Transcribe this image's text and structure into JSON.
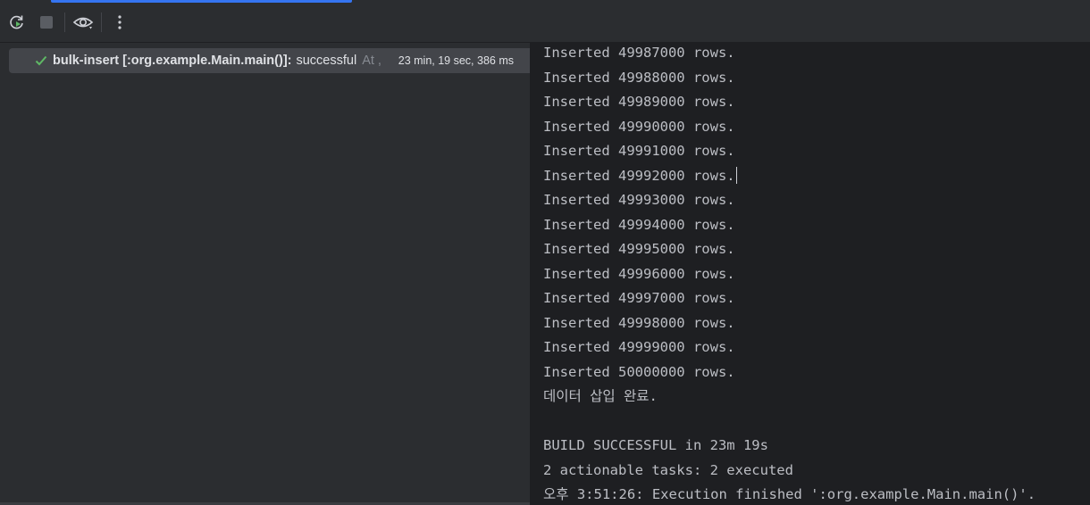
{
  "toolbar": {
    "rerun_icon": "rerun-icon",
    "stop_icon": "stop-icon",
    "view_icon": "eye-icon",
    "more_icon": "more-vertical-icon"
  },
  "tree": {
    "name": "bulk-insert [:org.example.Main.main()]:",
    "status": "successful",
    "at": "At ,",
    "duration": "23 min, 19 sec, 386 ms",
    "status_icon": "checkmark-icon"
  },
  "console": {
    "lines": [
      "Inserted 49987000 rows.",
      "Inserted 49988000 rows.",
      "Inserted 49989000 rows.",
      "Inserted 49990000 rows.",
      "Inserted 49991000 rows.",
      "Inserted 49992000 rows.",
      "Inserted 49993000 rows.",
      "Inserted 49994000 rows.",
      "Inserted 49995000 rows.",
      "Inserted 49996000 rows.",
      "Inserted 49997000 rows.",
      "Inserted 49998000 rows.",
      "Inserted 49999000 rows.",
      "Inserted 50000000 rows.",
      "데이터 삽입 완료.",
      "",
      "BUILD SUCCESSFUL in 23m 19s",
      "2 actionable tasks: 2 executed",
      "오후 3:51:26: Execution finished ':org.example.Main.main()'."
    ]
  },
  "colors": {
    "accent": "#3574f0",
    "success": "#5fb865",
    "panel": "#2b2d30",
    "console_bg": "#1e1f22"
  }
}
